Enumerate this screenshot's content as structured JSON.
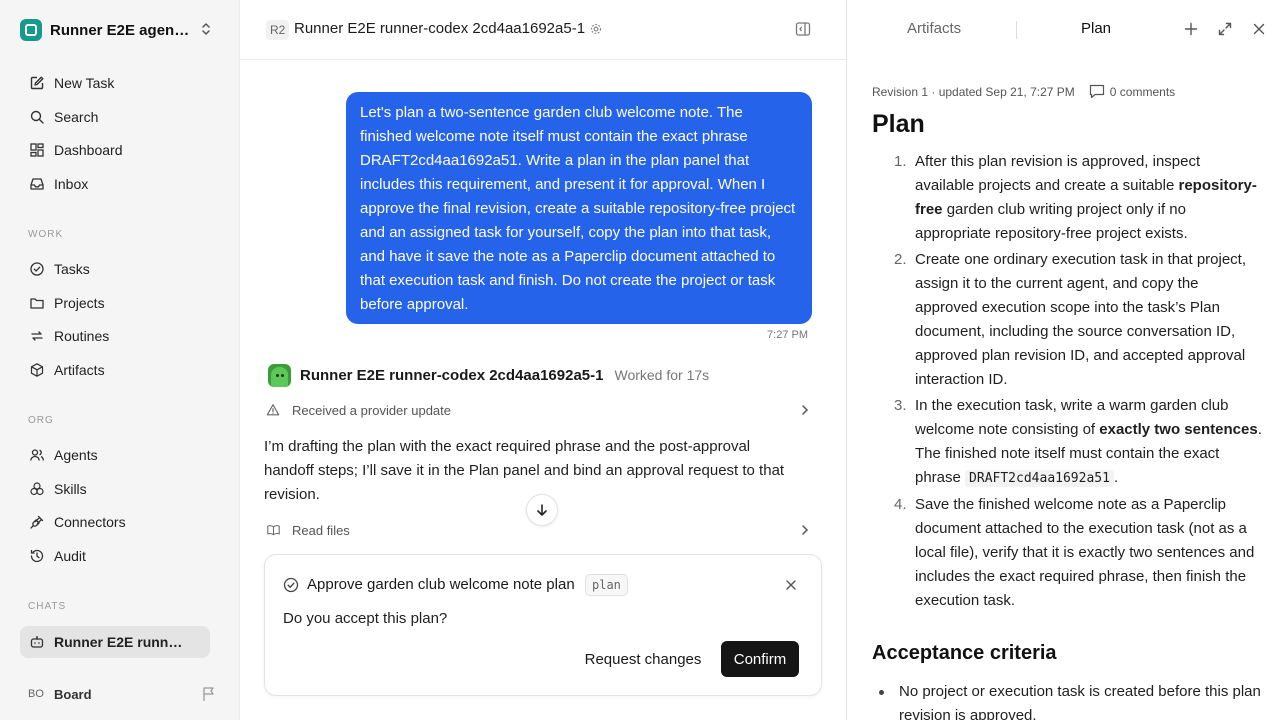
{
  "sidebar": {
    "workspace_name": "Runner E2E agen…",
    "nav": [
      {
        "label": "New Task",
        "icon": "edit-icon"
      },
      {
        "label": "Search",
        "icon": "search-icon"
      },
      {
        "label": "Dashboard",
        "icon": "dashboard-icon"
      },
      {
        "label": "Inbox",
        "icon": "inbox-icon"
      }
    ],
    "work_label": "WORK",
    "work": [
      {
        "label": "Tasks",
        "icon": "check-circle-icon"
      },
      {
        "label": "Projects",
        "icon": "folder-icon"
      },
      {
        "label": "Routines",
        "icon": "repeat-icon"
      },
      {
        "label": "Artifacts",
        "icon": "cube-icon"
      }
    ],
    "org_label": "ORG",
    "org": [
      {
        "label": "Agents",
        "icon": "users-icon"
      },
      {
        "label": "Skills",
        "icon": "skills-icon"
      },
      {
        "label": "Connectors",
        "icon": "plug-icon"
      },
      {
        "label": "Audit",
        "icon": "history-icon"
      }
    ],
    "chats_label": "CHATS",
    "chats": [
      {
        "label": "Runner E2E runn…",
        "icon": "chat-bot-icon"
      }
    ],
    "board": {
      "initials": "BO",
      "label": "Board"
    }
  },
  "conversation": {
    "badge": "R2",
    "title": "Runner E2E runner-codex 2cd4aa1692a5-1",
    "user_message": "Let's plan a two-sentence garden club welcome note. The finished welcome note itself must contain the exact phrase DRAFT2cd4aa1692a51. Write a plan in the plan panel that includes this requirement, and present it for approval. When I approve the final revision, create a suitable repository-free project and an assigned task for yourself, copy the plan into that task, and have it save the note as a Paperclip document attached to that execution task and finish. Do not create the project or task before approval.",
    "user_time": "7:27 PM",
    "agent_name": "Runner E2E runner-codex 2cd4aa1692a5-1",
    "worked_for": "Worked for 17s",
    "provider_update": "Received a provider update",
    "agent_message": "I’m drafting the plan with the exact required phrase and the post-approval handoff steps; I’ll save it in the Plan panel and bind an approval request to that revision.",
    "read_files": "Read files"
  },
  "approval": {
    "title": "Approve garden club welcome note plan",
    "tag": "plan",
    "question": "Do you accept this plan?",
    "request_changes": "Request changes",
    "confirm": "Confirm"
  },
  "panel": {
    "tabs": [
      "Artifacts",
      "Plan"
    ],
    "revision": "Revision 1 · updated Sep 21, 7:27 PM",
    "comments": "0 comments",
    "plan_title": "Plan",
    "steps": [
      {
        "num": "1.",
        "a": "After this plan revision is approved, inspect available projects and create a suitable ",
        "b": "repository-free",
        "c": " garden club writing project only if no appropriate repository-free project exists."
      },
      {
        "num": "2.",
        "text": "Create one ordinary execution task in that project, assign it to the current agent, and copy the approved execution scope into the task’s Plan document, including the source conversation ID, approved plan revision ID, and accepted approval interaction ID."
      },
      {
        "num": "3.",
        "a": "In the execution task, write a warm garden club welcome note consisting of ",
        "b": "exactly two sentences",
        "c": ". The finished note itself must contain the exact phrase ",
        "code": "DRAFT2cd4aa1692a51",
        "d": "."
      },
      {
        "num": "4.",
        "text": "Save the finished welcome note as a Paperclip document attached to the execution task (not as a local file), verify that it is exactly two sentences and includes the exact required phrase, then finish the execution task."
      }
    ],
    "acceptance_title": "Acceptance criteria",
    "acceptance": [
      "No project or execution task is created before this plan revision is approved."
    ]
  },
  "colors": {
    "accent": "#2563eb",
    "workspace_logo": "#169a8c",
    "confirm_button": "#151515"
  }
}
